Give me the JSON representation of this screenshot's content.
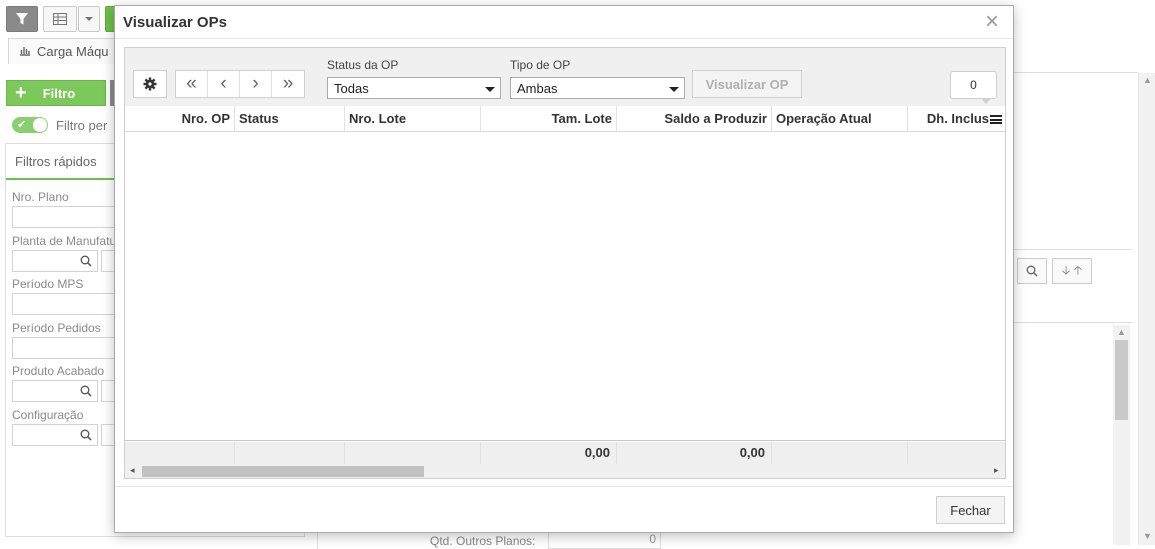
{
  "background": {
    "carga_tab": "Carga Máqu",
    "filtro_button": "Filtro",
    "filtro_toggle_label": "Filtro per",
    "filtros_rapidos_tab": "Filtros rápidos",
    "fields": [
      {
        "label": "Nro. Plano"
      },
      {
        "label": "Planta de Manufatu"
      },
      {
        "label": "Período MPS"
      },
      {
        "label": "Período Pedidos"
      },
      {
        "label": "Produto Acabado"
      },
      {
        "label": "Configuração"
      }
    ],
    "qtd_outros_planos_label": "Qtd. Outros Planos:",
    "qtd_outros_planos_value": "0"
  },
  "modal": {
    "title": "Visualizar OPs",
    "close_icon": "×",
    "toolbar": {
      "status_label": "Status da OP",
      "status_value": "Todas",
      "tipo_label": "Tipo de OP",
      "tipo_value": "Ambas",
      "visualizar_button": "Visualizar OP",
      "record_count": "0"
    },
    "grid": {
      "columns": [
        "Nro. OP",
        "Status",
        "Nro. Lote",
        "Tam. Lote",
        "Saldo a Produzir",
        "Operação Atual",
        "Dh. Inclus"
      ],
      "rows": [],
      "footer": {
        "tam_lote_total": "0,00",
        "saldo_total": "0,00"
      }
    },
    "footer": {
      "fechar_button": "Fechar"
    }
  },
  "colors": {
    "accent_green": "#7cc85a",
    "modal_border": "#a9a9a9"
  },
  "icons": {
    "gear": "gear-icon",
    "first": "double-chevron-left-icon",
    "prev": "chevron-left-icon",
    "next": "chevron-right-icon",
    "last": "double-chevron-right-icon",
    "columns_menu": "menu-icon",
    "search": "search-icon",
    "close": "close-icon"
  }
}
